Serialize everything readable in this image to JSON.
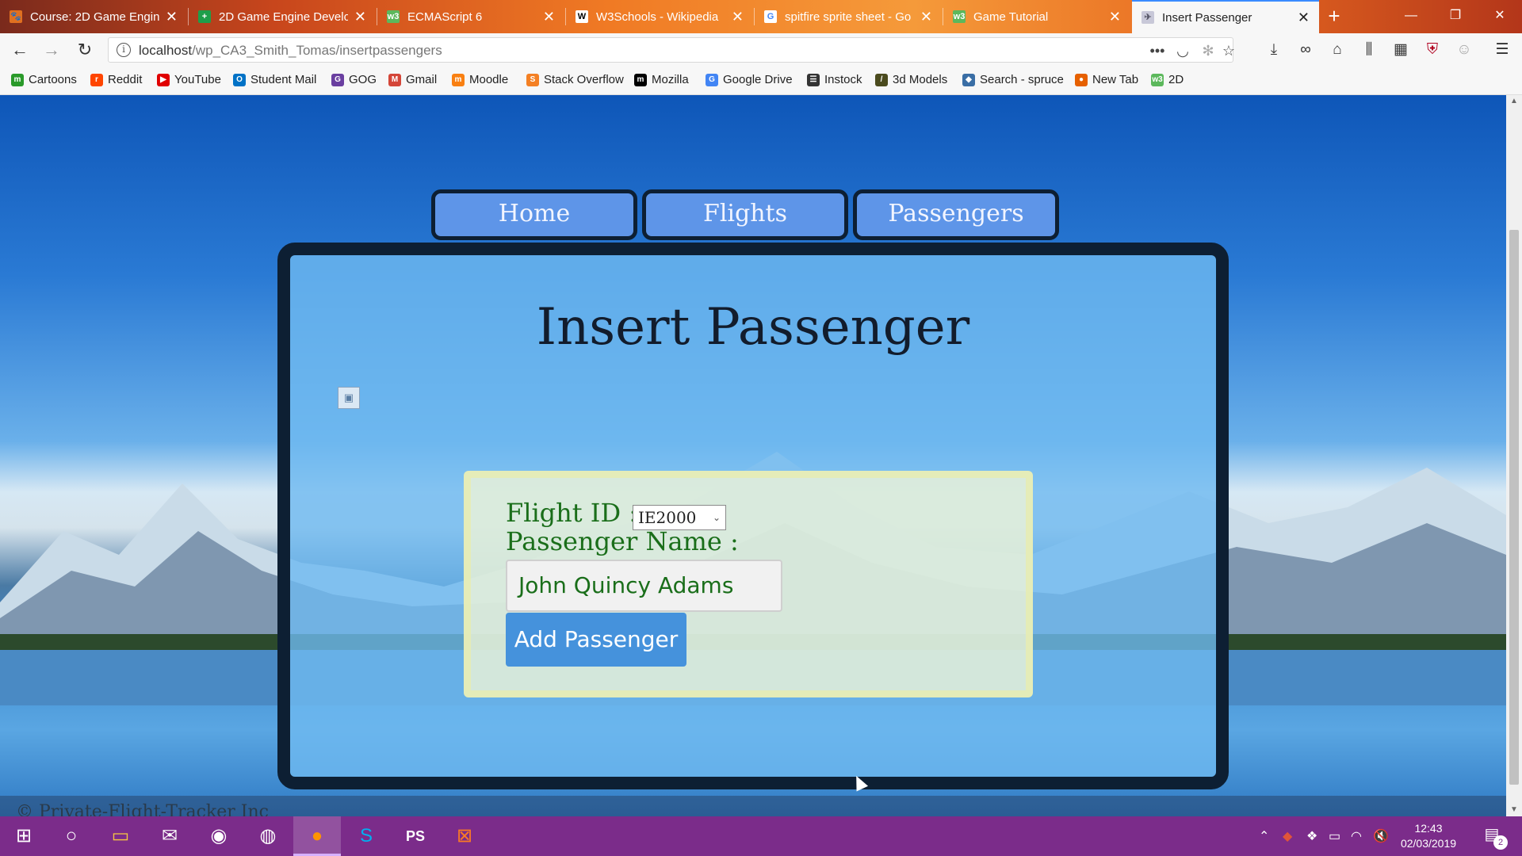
{
  "browser": {
    "tabs": [
      {
        "title": "Course: 2D Game Engine",
        "favicon_color": "#e07020",
        "favicon_glyph": "🐾"
      },
      {
        "title": "2D Game Engine Develo",
        "favicon_color": "#1e9e4a",
        "favicon_glyph": "+"
      },
      {
        "title": "ECMAScript 6",
        "favicon_color": "#5cb85c",
        "favicon_glyph": "w3"
      },
      {
        "title": "W3Schools - Wikipedia",
        "favicon_color": "#ffffff",
        "favicon_glyph": "W"
      },
      {
        "title": "spitfire sprite sheet - Go",
        "favicon_color": "#ffffff",
        "favicon_glyph": "G"
      },
      {
        "title": "Game Tutorial",
        "favicon_color": "#5cb85c",
        "favicon_glyph": "w3"
      },
      {
        "title": "Insert Passenger",
        "favicon_color": "#c8c8d8",
        "favicon_glyph": "✈"
      }
    ],
    "url_host": "localhost",
    "url_path": "/wp_CA3_Smith_Tomas/insertpassengers",
    "bookmarks": [
      {
        "label": "Cartoons",
        "color": "#2a9a2a",
        "glyph": "m"
      },
      {
        "label": "Reddit",
        "color": "#ff4500",
        "glyph": "r"
      },
      {
        "label": "YouTube",
        "color": "#e00000",
        "glyph": "▶"
      },
      {
        "label": "Student Mail",
        "color": "#0072c6",
        "glyph": "O"
      },
      {
        "label": "GOG",
        "color": "#6a3fa0",
        "glyph": "G"
      },
      {
        "label": "Gmail",
        "color": "#d44638",
        "glyph": "M"
      },
      {
        "label": "Moodle",
        "color": "#f98012",
        "glyph": "m"
      },
      {
        "label": "Stack Overflow",
        "color": "#f48024",
        "glyph": "S"
      },
      {
        "label": "Mozilla",
        "color": "#000000",
        "glyph": "m"
      },
      {
        "label": "Google Drive",
        "color": "#4285f4",
        "glyph": "G"
      },
      {
        "label": "Instock",
        "color": "#333333",
        "glyph": "☰"
      },
      {
        "label": "3d Models",
        "color": "#4b4b1e",
        "glyph": "/"
      },
      {
        "label": "Search - spruce",
        "color": "#3a6ea5",
        "glyph": "◆"
      },
      {
        "label": "New Tab",
        "color": "#e66000",
        "glyph": "●"
      },
      {
        "label": "2D",
        "color": "#5cb85c",
        "glyph": "w3"
      }
    ]
  },
  "site": {
    "nav": [
      "Home",
      "Flights",
      "Passengers"
    ],
    "title": "Insert Passenger",
    "form": {
      "flight_id_label": "Flight ID :",
      "flight_id_value": "IE2000",
      "passenger_name_label": "Passenger Name :",
      "passenger_name_value": "John Quincy Adams",
      "submit_label": "Add Passenger"
    },
    "footer": "© Private-Flight-Tracker Inc"
  },
  "taskbar": {
    "time": "12:43",
    "date": "02/03/2019",
    "notification_count": "2"
  }
}
